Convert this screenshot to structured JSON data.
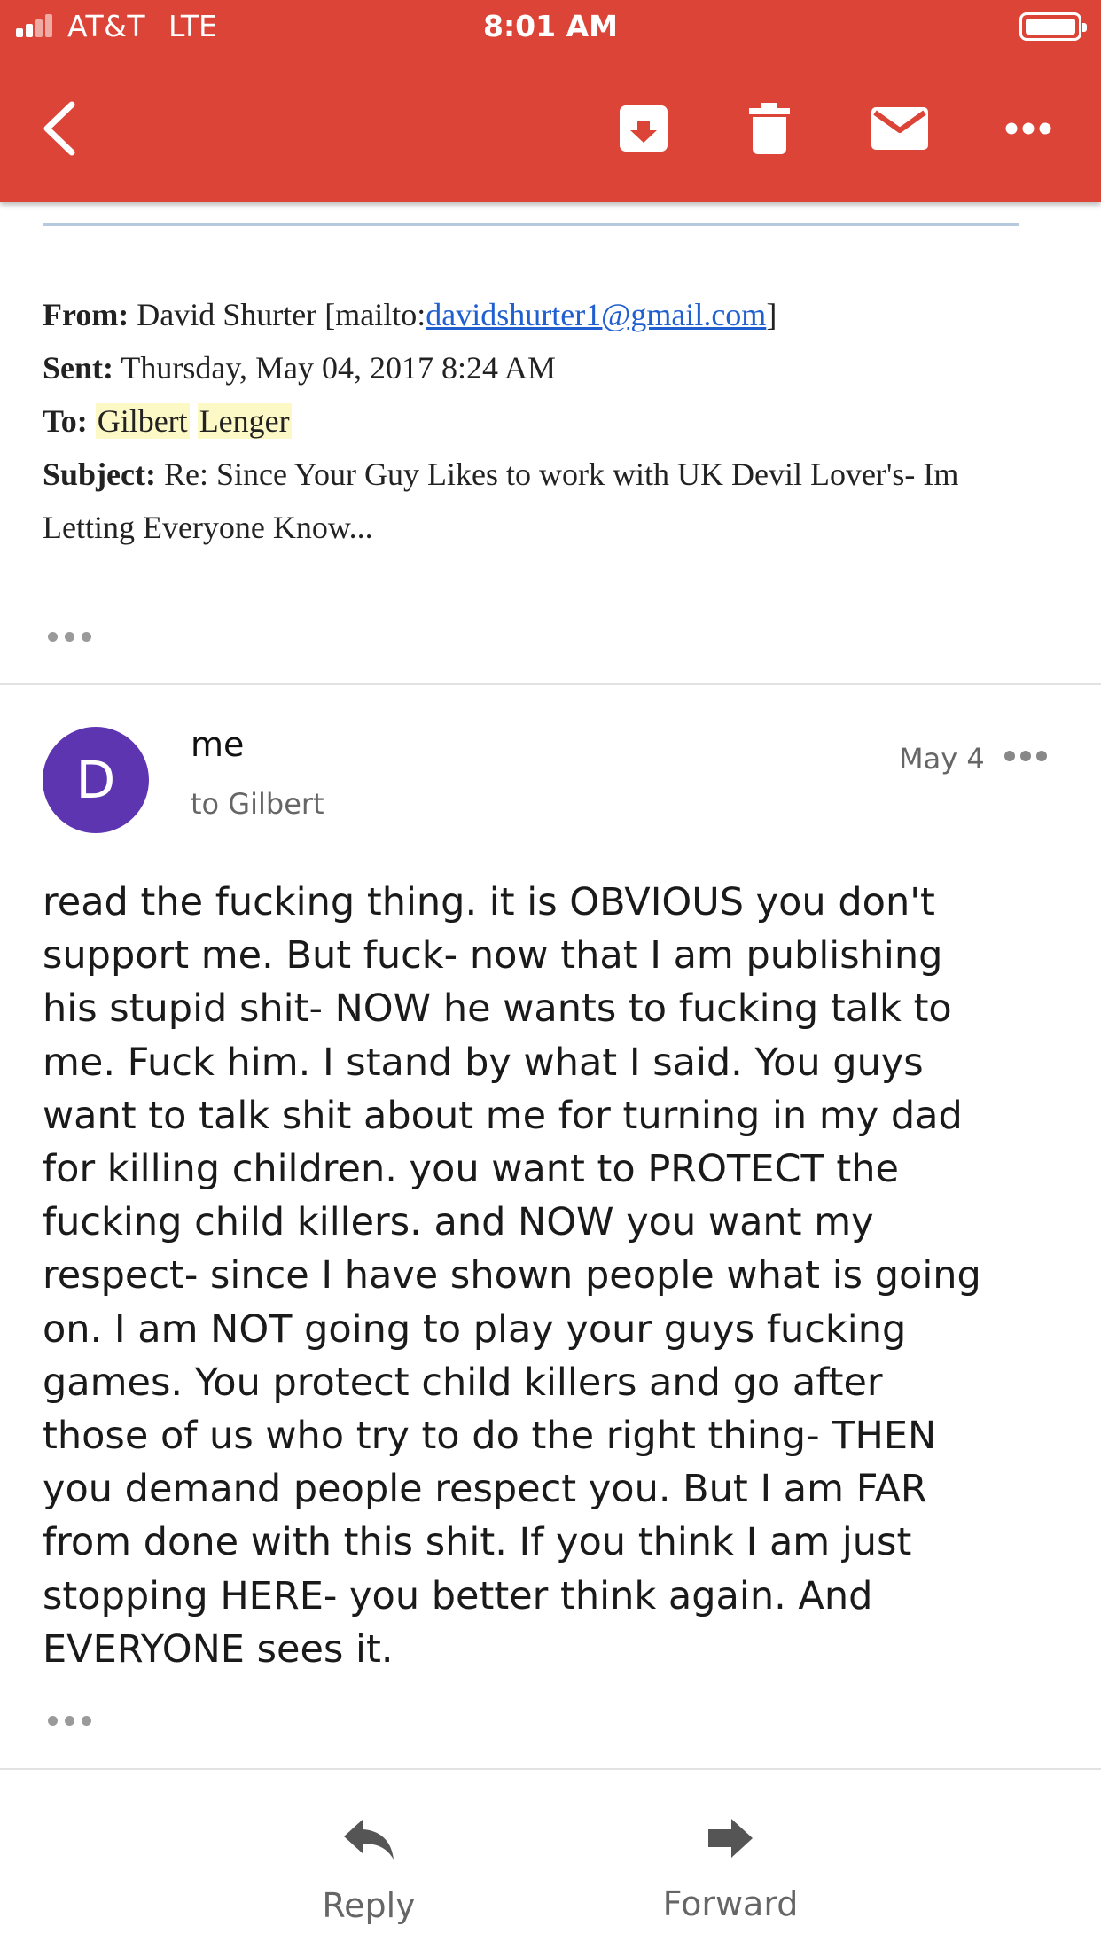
{
  "status_bar": {
    "carrier": "AT&T",
    "network": "LTE",
    "time": "8:01 AM"
  },
  "toolbar": {
    "back_icon": "chevron-left-icon",
    "actions": [
      "archive-icon",
      "trash-icon",
      "mail-icon",
      "more-vert-icon"
    ],
    "accent_color": "#db4437"
  },
  "quoted_header": {
    "from_label": "From:",
    "from_name": "David Shurter [mailto:",
    "from_email": "davidshurter1@gmail.com",
    "from_close": "]",
    "sent_label": "Sent:",
    "sent_value": "Thursday, May 04, 2017 8:24 AM",
    "to_label": "To:",
    "to_first": "Gilbert",
    "to_last": "Lenger",
    "subject_label": "Subject:",
    "subject_value": "Re: Since Your Guy Likes to work with UK Devil Lover's- Im Letting Everyone Know..."
  },
  "message": {
    "avatar_letter": "D",
    "avatar_color": "#5e35b1",
    "sender": "me",
    "recipient": "to Gilbert",
    "date": "May 4",
    "body": "read the fucking thing.  it is OBVIOUS you don't\nsupport me.  But fuck- now that I am publishing\nhis stupid shit- NOW he wants to fucking talk to\nme.  Fuck him.  I stand by what I said.  You guys\nwant to talk shit about me for turning in my dad\nfor killing children.  you want to PROTECT the\nfucking child killers.  and NOW you want my\nrespect- since I have shown people what is going\non.  I am NOT going to play your guys fucking\ngames.  You protect child killers and go after\nthose of us who try to do the right thing- THEN\nyou demand people respect you.  But I am FAR\nfrom done with this shit.  If you think I am just\nstopping HERE- you better think again.  And\nEVERYONE sees it."
  },
  "bottom_actions": {
    "reply": "Reply",
    "forward": "Forward"
  }
}
